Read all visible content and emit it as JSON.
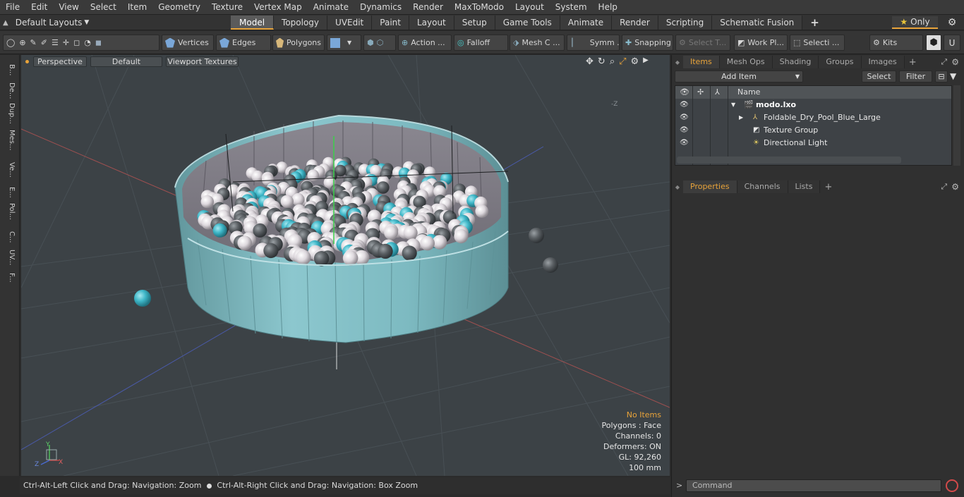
{
  "menubar": [
    "File",
    "Edit",
    "View",
    "Select",
    "Item",
    "Geometry",
    "Texture",
    "Vertex Map",
    "Animate",
    "Dynamics",
    "Render",
    "MaxToModo",
    "Layout",
    "System",
    "Help"
  ],
  "layoutbar": {
    "layout_dropdown": "Default Layouts",
    "tabs": [
      "Model",
      "Topology",
      "UVEdit",
      "Paint",
      "Layout",
      "Setup",
      "Game Tools",
      "Animate",
      "Render",
      "Scripting",
      "Schematic Fusion"
    ],
    "active_tab": "Model",
    "add_tab": "+",
    "only_label": "Only"
  },
  "toolbar": {
    "vertices": "Vertices",
    "edges": "Edges",
    "polygons": "Polygons",
    "action": "Action ...",
    "falloff": "Falloff",
    "mesh": "Mesh C ...",
    "symm": "Symm ...",
    "snapping": "Snapping",
    "select_t": "Select T...",
    "work_pl": "Work Pl...",
    "selecti": "Selecti ...",
    "kits": "Kits"
  },
  "leftstrip": [
    "B...",
    "De...",
    "Dup...",
    "Mes...",
    "Ve...",
    "E...",
    "Pol...",
    "C...",
    "UV...",
    "F..."
  ],
  "viewport": {
    "view_mode": "Perspective",
    "shading": "Default",
    "textures": "Viewport Textures",
    "axis_z_label": "-Z",
    "info": {
      "items": "No Items",
      "polygons": "Polygons : Face",
      "channels": "Channels: 0",
      "deformers": "Deformers: ON",
      "gl": "GL: 92,260",
      "scale": "100 mm"
    },
    "gizmo": {
      "y": "Y",
      "z": "Z",
      "x": "X"
    }
  },
  "statusbar": {
    "hint_left": "Ctrl-Alt-Left Click and Drag: Navigation: Zoom",
    "hint_right": "Ctrl-Alt-Right Click and Drag: Navigation: Box Zoom"
  },
  "items_panel": {
    "tabs": [
      "Items",
      "Mesh Ops",
      "Shading",
      "Groups",
      "Images"
    ],
    "active_tab": "Items",
    "add_item": "Add Item",
    "select": "Select",
    "filter": "Filter",
    "column_name": "Name",
    "rows": [
      {
        "name": "modo.lxo"
      },
      {
        "name": "Foldable_Dry_Pool_Blue_Large"
      },
      {
        "name": "Texture Group"
      },
      {
        "name": "Directional Light"
      }
    ]
  },
  "props_panel": {
    "tabs": [
      "Properties",
      "Channels",
      "Lists"
    ],
    "active_tab": "Properties",
    "add": "+"
  },
  "command": {
    "placeholder": "Command"
  },
  "colors": {
    "accent": "#e8a33a",
    "pool": "#7fbcc3",
    "ball_cyan": "#3fb7c8",
    "ball_white": "#e6e2e6",
    "ball_grey": "#555a5e"
  }
}
